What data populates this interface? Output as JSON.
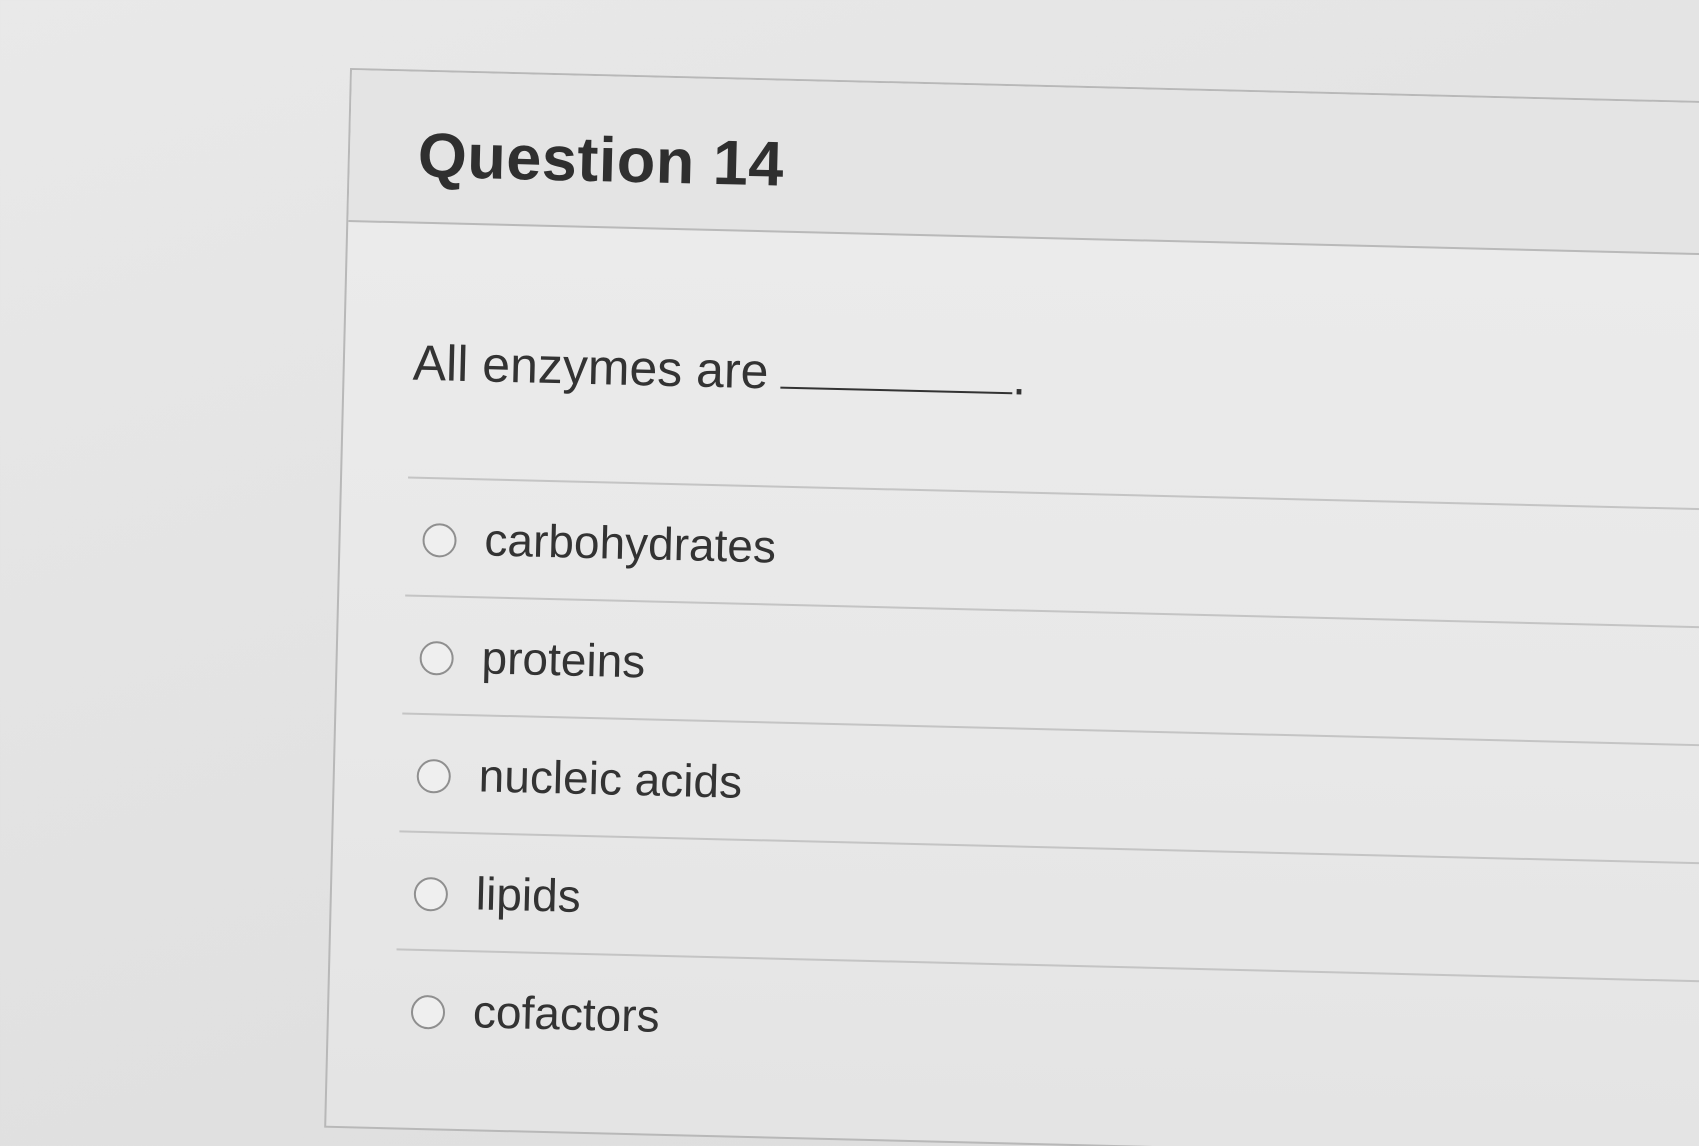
{
  "question": {
    "title": "Question 14",
    "prompt": "All enzymes are",
    "prompt_suffix": "."
  },
  "options": [
    {
      "label": "carbohydrates",
      "selected": false
    },
    {
      "label": "proteins",
      "selected": false
    },
    {
      "label": "nucleic acids",
      "selected": false
    },
    {
      "label": "lipids",
      "selected": false
    },
    {
      "label": "cofactors",
      "selected": false
    }
  ]
}
